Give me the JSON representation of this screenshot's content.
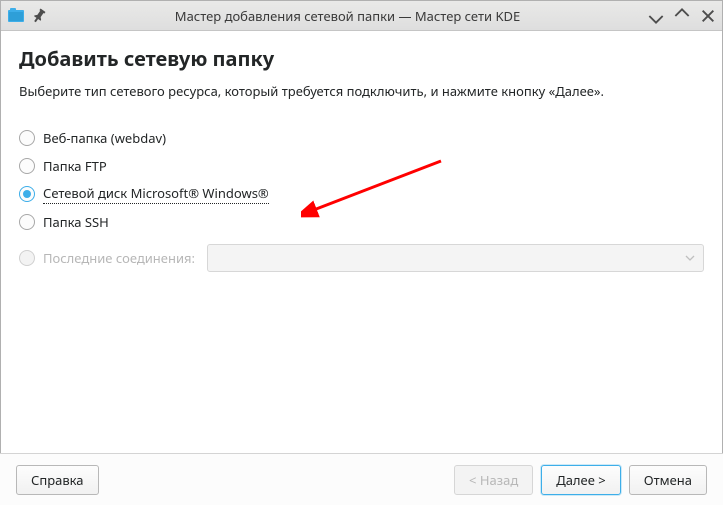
{
  "window": {
    "title": "Мастер добавления сетевой папки — Мастер сети KDE"
  },
  "page": {
    "title": "Добавить сетевую папку",
    "description": "Выберите тип сетевого ресурса, который требуется подключить, и нажмите кнопку «Далее»."
  },
  "options": {
    "webdav": "Веб-папка (webdav)",
    "ftp": "Папка FTP",
    "windows": "Сетевой диск Microsoft® Windows®",
    "ssh": "Папка SSH",
    "recent": "Последние соединения:"
  },
  "footer": {
    "help": "Справка",
    "back": "< Назад",
    "next": "Далее >",
    "cancel": "Отмена"
  }
}
